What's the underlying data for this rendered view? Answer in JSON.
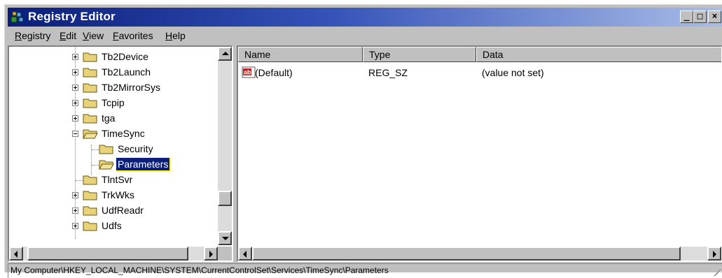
{
  "window": {
    "title": "Registry Editor",
    "controls": {
      "minimize": "_",
      "maximize": "□",
      "close": "×"
    }
  },
  "menu": [
    {
      "label": "Registry",
      "mnemonic": "R",
      "rest": "egistry"
    },
    {
      "label": "Edit",
      "mnemonic": "E",
      "rest": "dit"
    },
    {
      "label": "View",
      "mnemonic": "V",
      "rest": "iew"
    },
    {
      "label": "Favorites",
      "mnemonic": "F",
      "rest": "avorites"
    },
    {
      "label": "Help",
      "mnemonic": "H",
      "rest": "elp"
    }
  ],
  "tree": {
    "items": [
      {
        "label": "Tb2Device",
        "expander": "plus"
      },
      {
        "label": "Tb2Launch",
        "expander": "plus"
      },
      {
        "label": "Tb2MirrorSys",
        "expander": "plus"
      },
      {
        "label": "Tcpip",
        "expander": "plus"
      },
      {
        "label": "tga",
        "expander": "plus"
      },
      {
        "label": "TimeSync",
        "expander": "minus"
      },
      {
        "label": "Security",
        "expander": "none"
      },
      {
        "label": "Parameters",
        "expander": "none",
        "selected": true
      },
      {
        "label": "TlntSvr",
        "expander": "none"
      },
      {
        "label": "TrkWks",
        "expander": "plus"
      },
      {
        "label": "UdfReadr",
        "expander": "plus"
      },
      {
        "label": "Udfs",
        "expander": "plus"
      }
    ]
  },
  "list": {
    "columns": [
      "Name",
      "Type",
      "Data"
    ],
    "rows": [
      {
        "icon": "string-value-icon",
        "icon_text": "ab",
        "name": "(Default)",
        "type": "REG_SZ",
        "data": "(value not set)"
      }
    ]
  },
  "status": {
    "path": "My Computer\\HKEY_LOCAL_MACHINE\\SYSTEM\\CurrentControlSet\\Services\\TimeSync\\Parameters"
  },
  "colors": {
    "title_gradient_start": "#0a1e7a",
    "title_gradient_end": "#a9bde8",
    "selection": "#0a1e7a",
    "folder": "#e8d27a",
    "chrome": "#c0c0c0"
  }
}
